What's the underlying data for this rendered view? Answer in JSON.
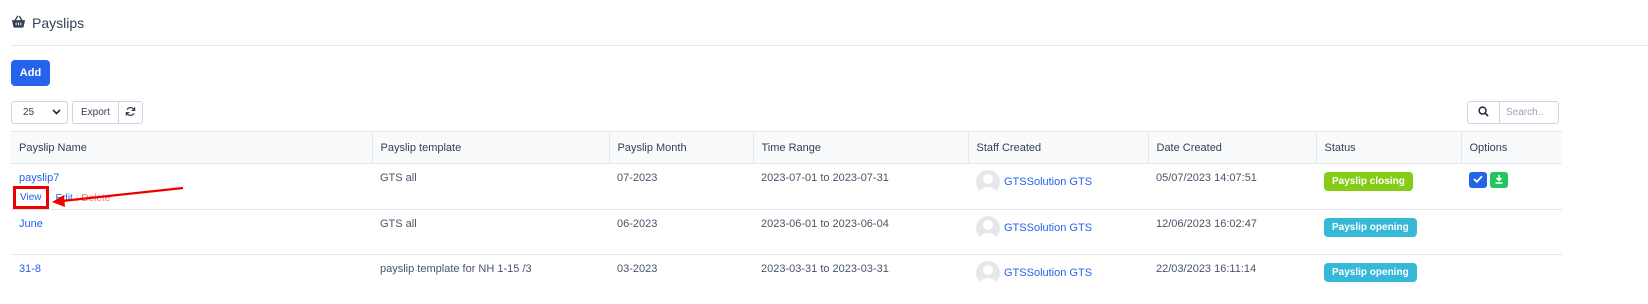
{
  "page": {
    "title": "Payslips"
  },
  "toolbar": {
    "add_label": "Add",
    "page_size": "25",
    "export_label": "Export"
  },
  "search": {
    "placeholder": "Search.."
  },
  "table": {
    "headers": [
      "Payslip Name",
      "Payslip template",
      "Payslip Month",
      "Time Range",
      "Staff Created",
      "Date Created",
      "Status",
      "Options"
    ],
    "row_actions": {
      "view": "View",
      "edit": "Edit",
      "separator": "|",
      "delete": "Delete"
    },
    "rows": [
      {
        "name": "payslip7",
        "template": "GTS all",
        "month": "07-2023",
        "range": "2023-07-01 to 2023-07-31",
        "staff": "GTSSolution GTS",
        "date": "05/07/2023 14:07:51",
        "status": "Payslip closing"
      },
      {
        "name": "June",
        "template": "GTS all",
        "month": "06-2023",
        "range": "2023-06-01 to 2023-06-04",
        "staff": "GTSSolution GTS",
        "date": "12/06/2023 16:02:47",
        "status": "Payslip opening"
      },
      {
        "name": "31-8",
        "template": "payslip template for NH 1-15 /3",
        "month": "03-2023",
        "range": "2023-03-31 to 2023-03-31",
        "staff": "GTSSolution GTS",
        "date": "22/03/2023 16:11:14",
        "status": "Payslip opening"
      }
    ]
  },
  "colors": {
    "primary": "#2563eb",
    "success": "#84cc16",
    "info": "#36b9d6",
    "download": "#22c55e",
    "highlight": "#ef0000"
  },
  "icons": {
    "header": "basket-icon",
    "refresh": "refresh-icon",
    "search": "search-icon",
    "check": "check-icon",
    "download": "download-icon",
    "avatar": "user-avatar-icon"
  }
}
